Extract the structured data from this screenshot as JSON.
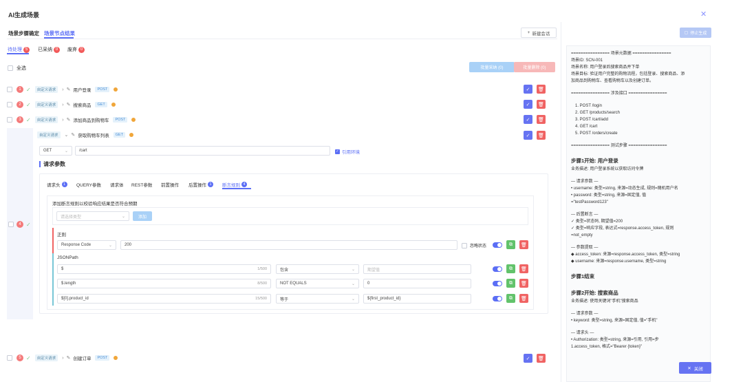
{
  "header": {
    "title": "AI生成场景"
  },
  "tabs": {
    "confirm": "场景步骤确定",
    "result": "场景节点结果",
    "new_session": "新建会话"
  },
  "status_tabs": [
    {
      "label": "待处理",
      "count": "5"
    },
    {
      "label": "已采纳",
      "count": "0"
    },
    {
      "label": "废弃",
      "count": "0"
    }
  ],
  "select_all": "全选",
  "bulk": {
    "adopt": "批量采纳 (0)",
    "delete": "批量删除 (0)"
  },
  "steps": [
    {
      "num": "1",
      "tag": "自定义请求",
      "name": "用户登录",
      "method": "POST"
    },
    {
      "num": "2",
      "tag": "自定义请求",
      "name": "搜索商品",
      "method": "GET"
    },
    {
      "num": "3",
      "tag": "自定义请求",
      "name": "添加商品到购物车",
      "method": "POST"
    },
    {
      "num": "4",
      "tag": "自定义请求",
      "name": "获取购物车列表",
      "method": "GET"
    },
    {
      "num": "5",
      "tag": "自定义请求",
      "name": "创建订单",
      "method": "POST"
    }
  ],
  "request": {
    "method": "GET",
    "url": "/cart",
    "use_env": "引用环境"
  },
  "params_title": "请求参数",
  "sub_tabs": [
    {
      "label": "请求头",
      "count": "1"
    },
    {
      "label": "QUERY参数",
      "count": ""
    },
    {
      "label": "请求体",
      "count": ""
    },
    {
      "label": "REST参数",
      "count": ""
    },
    {
      "label": "前置操作",
      "count": ""
    },
    {
      "label": "后置操作",
      "count": "1"
    },
    {
      "label": "断言规则",
      "count": "4"
    }
  ],
  "assertion": {
    "hint": "添加断言规则以校验响应结果是否符合预期",
    "type_placeholder": "请选择类型",
    "add": "添加",
    "regex_label": "正则",
    "rc_field": "Response Code",
    "rc_value": "200",
    "ignore_status": "忽略状态",
    "jsonpath_label": "JSONPath",
    "rows": [
      {
        "path": "$",
        "count": "1/500",
        "op": "包含",
        "value": "",
        "value_placeholder": "期望值"
      },
      {
        "path": "$.length",
        "count": "8/500",
        "op": "NOT EQUALS",
        "value": "0",
        "value_placeholder": ""
      },
      {
        "path": "$[0].product_id",
        "count": "15/500",
        "op": "等于",
        "value": "${first_product_id}",
        "value_placeholder": ""
      }
    ]
  },
  "right": {
    "stop_btn": "停止生成",
    "close_btn": "关闭",
    "lines": [
      {
        "t": "text",
        "v": "================ 场景元数据 ================"
      },
      {
        "t": "text",
        "v": "场景ID: SCN-001"
      },
      {
        "t": "text",
        "v": "场景名称: 用户登录后搜索商品并下单"
      },
      {
        "t": "text",
        "v": "场景目标: 验证用户完整的购物流程，包括登录、搜索商品、添"
      },
      {
        "t": "text",
        "v": "加商品到购物车、查看购物车以及创建订单。"
      },
      {
        "t": "blank",
        "v": ""
      },
      {
        "t": "text",
        "v": "================ 涉及接口 ================"
      },
      {
        "t": "blank",
        "v": ""
      },
      {
        "t": "li",
        "v": "1. POST /login"
      },
      {
        "t": "li",
        "v": "2. GET /products/search"
      },
      {
        "t": "li",
        "v": "3. POST /cart/add"
      },
      {
        "t": "li",
        "v": "4. GET /cart"
      },
      {
        "t": "li",
        "v": "5. POST /orders/create"
      },
      {
        "t": "blank",
        "v": ""
      },
      {
        "t": "text",
        "v": "================ 测试步骤 ================"
      },
      {
        "t": "blank",
        "v": ""
      },
      {
        "t": "h",
        "v": "步骤1开始: 用户登录"
      },
      {
        "t": "text",
        "v": "业务描述: 用户登录系统以获取访问令牌"
      },
      {
        "t": "blank",
        "v": ""
      },
      {
        "t": "text",
        "v": "— 请求参数 —"
      },
      {
        "t": "text",
        "v": "• username: 类型=string, 来源=动态生成, 规则=随机用户名"
      },
      {
        "t": "text",
        "v": "• password: 类型=string, 来源=固定值, 值"
      },
      {
        "t": "text",
        "v": "=\"testPassword123\""
      },
      {
        "t": "blank",
        "v": ""
      },
      {
        "t": "text",
        "v": "— 后置断言 —"
      },
      {
        "t": "text",
        "v": "✓ 类型=状态码, 期望值=200"
      },
      {
        "t": "text",
        "v": "✓ 类型=响应字段, 表达式=response.access_token, 规则"
      },
      {
        "t": "text",
        "v": "=not_empty"
      },
      {
        "t": "blank",
        "v": ""
      },
      {
        "t": "text",
        "v": "— 参数提取 —"
      },
      {
        "t": "text",
        "v": "◆ access_token: 来源=response.access_token, 类型=string"
      },
      {
        "t": "text",
        "v": "◆ username: 来源=response.username, 类型=string"
      },
      {
        "t": "blank",
        "v": ""
      },
      {
        "t": "h",
        "v": "步骤1结束"
      },
      {
        "t": "blank",
        "v": ""
      },
      {
        "t": "h",
        "v": "步骤2开始: 搜索商品"
      },
      {
        "t": "text",
        "v": "业务描述: 使用关键词\"手机\"搜索商品"
      },
      {
        "t": "blank",
        "v": ""
      },
      {
        "t": "text",
        "v": "— 请求参数 —"
      },
      {
        "t": "text",
        "v": "• keyword: 类型=string, 来源=固定值, 值=\"手机\""
      },
      {
        "t": "blank",
        "v": ""
      },
      {
        "t": "text",
        "v": "— 请求头 —"
      },
      {
        "t": "text",
        "v": "• Authorization: 类型=string, 来源=引用, 引用=步"
      },
      {
        "t": "text",
        "v": "1.access_token, 格式=\"Bearer {token}\""
      }
    ]
  }
}
